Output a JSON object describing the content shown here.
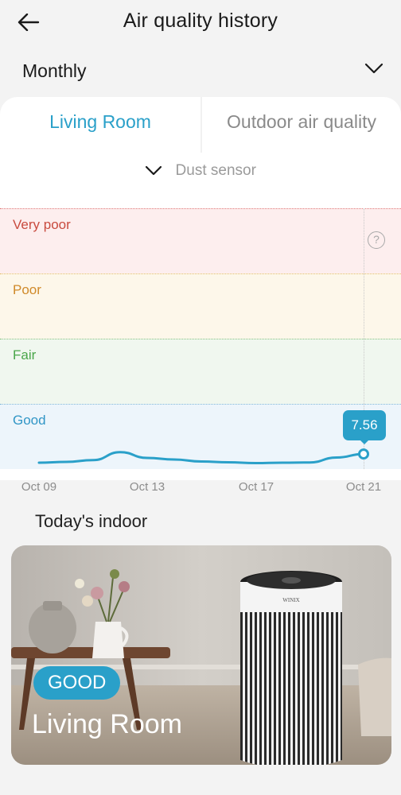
{
  "header": {
    "title": "Air quality history"
  },
  "period": {
    "label": "Monthly"
  },
  "tabs": [
    {
      "label": "Living Room",
      "active": true
    },
    {
      "label": "Outdoor air quality",
      "active": false
    }
  ],
  "sensor": {
    "label": "Dust sensor"
  },
  "levels": {
    "very_poor": "Very poor",
    "poor": "Poor",
    "fair": "Fair",
    "good": "Good"
  },
  "help_icon": "?",
  "chart_data": {
    "type": "line",
    "x_ticks": [
      "Oct 09",
      "Oct 13",
      "Oct 17",
      "Oct 21"
    ],
    "current_value": "7.56",
    "series": [
      {
        "color": "#2aa0c9",
        "points": [
          {
            "x": "Oct 09",
            "y": 3.2
          },
          {
            "x": "Oct 10",
            "y": 3.6
          },
          {
            "x": "Oct 11",
            "y": 4.5
          },
          {
            "x": "Oct 12",
            "y": 8.5
          },
          {
            "x": "Oct 13",
            "y": 5.6
          },
          {
            "x": "Oct 14",
            "y": 4.8
          },
          {
            "x": "Oct 15",
            "y": 3.8
          },
          {
            "x": "Oct 16",
            "y": 3.4
          },
          {
            "x": "Oct 17",
            "y": 3.0
          },
          {
            "x": "Oct 18",
            "y": 3.2
          },
          {
            "x": "Oct 19",
            "y": 3.3
          },
          {
            "x": "Oct 20",
            "y": 5.8
          },
          {
            "x": "Oct 21",
            "y": 7.56
          }
        ]
      }
    ]
  },
  "today": {
    "title": "Today's indoor",
    "status": "GOOD",
    "room": "Living Room",
    "brand": "WINIX"
  },
  "colors": {
    "accent": "#2aa0c9",
    "very_poor": "#c94b3f",
    "poor": "#d08a2a",
    "fair": "#4aa64a",
    "good": "#3196c6"
  }
}
